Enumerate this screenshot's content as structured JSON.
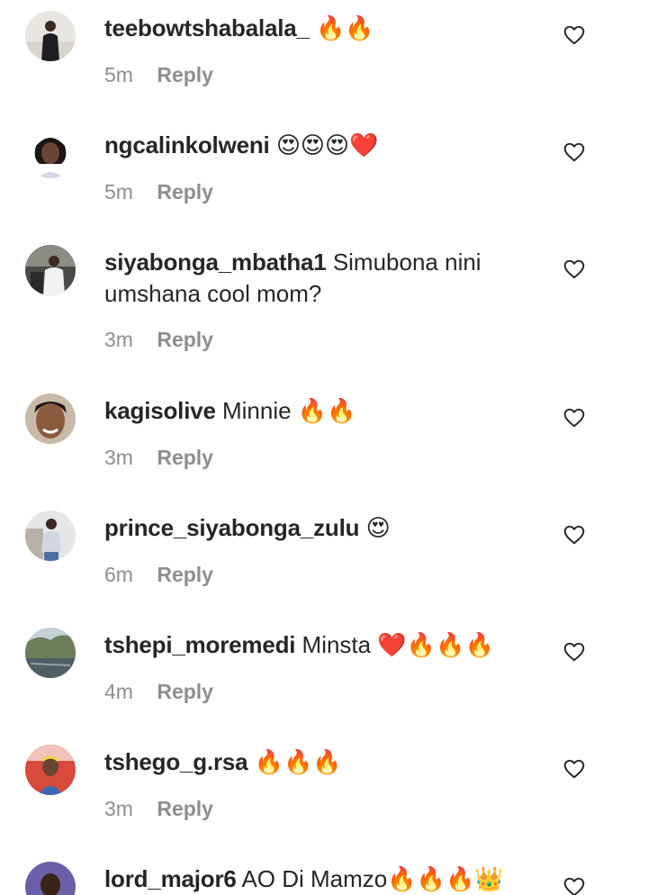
{
  "labels": {
    "reply": "Reply"
  },
  "comments": [
    {
      "username": "teebowtshabalala_",
      "text": "🔥🔥",
      "time": "5m"
    },
    {
      "username": "ngcalinkolweni",
      "text": "😍😍😍❤️",
      "time": "5m"
    },
    {
      "username": "siyabonga_mbatha1",
      "text": "Simubona nini umshana cool mom?",
      "time": "3m"
    },
    {
      "username": "kagisolive",
      "text": "Minnie 🔥🔥",
      "time": "3m"
    },
    {
      "username": "prince_siyabonga_zulu",
      "text": "😍",
      "time": "6m"
    },
    {
      "username": "tshepi_moremedi",
      "text": "Minsta ❤️🔥🔥🔥",
      "time": "4m"
    },
    {
      "username": "tshego_g.rsa",
      "text": "🔥🔥🔥",
      "time": "3m"
    },
    {
      "username": "lord_major6",
      "text": "AO Di Mamzo🔥🔥🔥👑👑",
      "time": ""
    }
  ]
}
